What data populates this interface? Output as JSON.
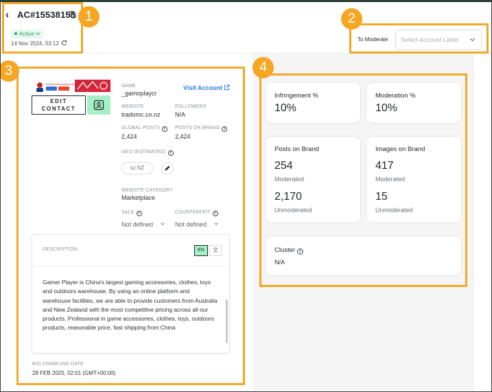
{
  "header": {
    "account_id": "AC#15538158",
    "status": "Active",
    "timestamp": "14 Nov 2024, 03:12",
    "moderate_label": "To Moderate",
    "select_placeholder": "Select Account Label"
  },
  "profile": {
    "logo_text": "The Best Accessories in Australia",
    "edit_contact_label": "EDIT CONTACT",
    "name_label": "NAME",
    "name_value": "_gamoplaycr",
    "visit_account_label": "Visit Account",
    "website_label": "WEBSITE",
    "website_value": "tradomc.co.nz",
    "followers_label": "FOLLOWERS",
    "followers_value": "N/A",
    "global_posts_label": "GLOBAL POSTS",
    "global_posts_value": "2,424",
    "posts_on_brand_label": "POSTS ON BRAND",
    "posts_on_brand_value": "2,424",
    "geo_label": "GEO (ESTIMATED)",
    "geo_code": "NZ",
    "geo_value": "NZ",
    "website_category_label": "WEBSITE CATEGORY",
    "website_category_value": "Marketplace",
    "sale_label": "SALE",
    "sale_value": "Not defined",
    "counterfeit_label": "COUNTERFEIT",
    "counterfeit_value": "Not defined"
  },
  "description": {
    "title": "DESCRIPTION",
    "lang_en": "EN",
    "lang_zh": "文",
    "text": "Gamer Player is China's largest gaming accessories, clothes, toys and outdoors warehouse. By using an online platform and warehouse facilities, we are able to provide customers from Australia and New Zealand with the most competitive pricing across all our products. Professional in game accessories, clothes, toys, outdoors products, reasonable price, fast shipping from China"
  },
  "bio": {
    "label": "BIO CRAWLING DATE",
    "value": "28 FEB 2025, 02:01 (GMT+00:00)"
  },
  "stats": {
    "infringement_label": "Infringement %",
    "infringement_value": "10%",
    "moderation_label": "Moderation %",
    "moderation_value": "10%",
    "posts_label": "Posts on Brand",
    "posts_moderated": "254",
    "posts_moderated_label": "Moderated",
    "posts_unmoderated": "2,170",
    "posts_unmoderated_label": "Unmoderated",
    "images_label": "Images on Brand",
    "images_moderated": "417",
    "images_moderated_label": "Moderated",
    "images_unmoderated": "15",
    "images_unmoderated_label": "Unmoderated",
    "cluster_label": "Cluster",
    "cluster_value": "N/A"
  },
  "callouts": [
    "1",
    "2",
    "3",
    "4"
  ],
  "colors": {
    "callout": "#f5a623",
    "active_green": "#34a269",
    "mint": "#a6f0c8",
    "link_blue": "#2d7be5"
  }
}
